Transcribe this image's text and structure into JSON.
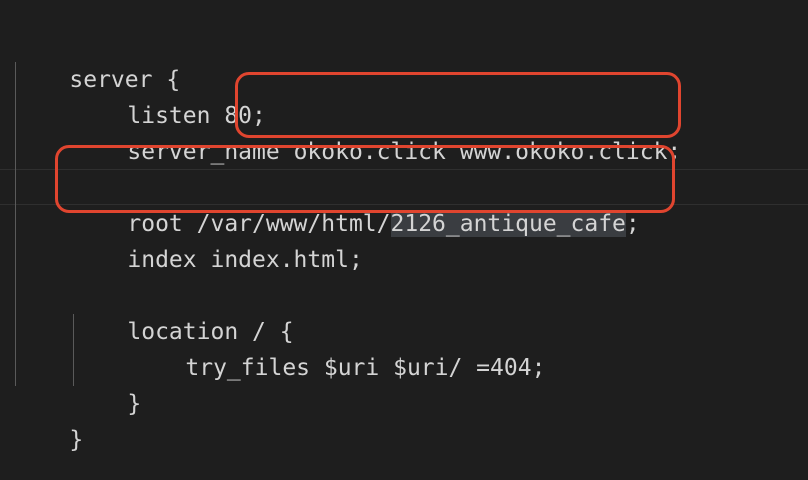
{
  "editor": {
    "colors": {
      "background": "#1e1e1e",
      "text": "#d4d4d4",
      "annotation": "#e0452f",
      "selection": "#3a3d41"
    },
    "lines": {
      "server_open": "server {",
      "listen": "listen 80;",
      "server_name_kw": "server_name ",
      "server_name_val": "okoko.click www.okoko.click;",
      "root_prefix": "root /var/www/html/",
      "root_selected": "2126_antique_cafe",
      "root_suffix": ";",
      "index": "index index.html;",
      "location_open": "location / {",
      "try_files": "try_files $uri $uri/ =404;",
      "location_close": "}",
      "server_close": "}"
    }
  }
}
